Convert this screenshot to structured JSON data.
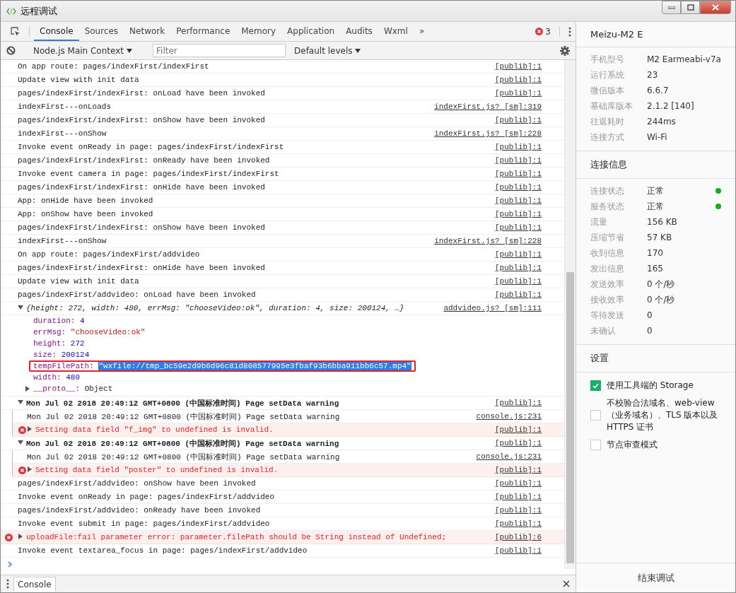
{
  "window": {
    "title": "远程调试"
  },
  "tabs": [
    {
      "label": "Console",
      "selected": true
    },
    {
      "label": "Sources",
      "selected": false
    },
    {
      "label": "Network",
      "selected": false
    },
    {
      "label": "Performance",
      "selected": false
    },
    {
      "label": "Memory",
      "selected": false
    },
    {
      "label": "Application",
      "selected": false
    },
    {
      "label": "Audits",
      "selected": false
    },
    {
      "label": "Wxml",
      "selected": false
    }
  ],
  "overflow": "»",
  "error_count": "3",
  "toolbar": {
    "context": "Node.js Main Context",
    "filter_placeholder": "Filter",
    "levels": "Default levels"
  },
  "console": [
    {
      "kind": "log",
      "text": "On app route: pages/indexFirst/indexFirst",
      "source": "[publib]:1"
    },
    {
      "kind": "log",
      "text": "Update view with init data",
      "source": "[publib]:1"
    },
    {
      "kind": "log",
      "text": "pages/indexFirst/indexFirst: onLoad have been invoked",
      "source": "[publib]:1"
    },
    {
      "kind": "log",
      "text": "indexFirst---onLoads",
      "source": "indexFirst.js? [sm]:319"
    },
    {
      "kind": "log",
      "text": "pages/indexFirst/indexFirst: onShow have been invoked",
      "source": "[publib]:1"
    },
    {
      "kind": "log",
      "text": "indexFirst---onShow",
      "source": "indexFirst.js? [sm]:228"
    },
    {
      "kind": "log",
      "text": "Invoke event onReady in page: pages/indexFirst/indexFirst",
      "source": "[publib]:1"
    },
    {
      "kind": "log",
      "text": "pages/indexFirst/indexFirst: onReady have been invoked",
      "source": "[publib]:1"
    },
    {
      "kind": "log",
      "text": "Invoke event camera in page: pages/indexFirst/indexFirst",
      "source": "[publib]:1"
    },
    {
      "kind": "log",
      "text": "pages/indexFirst/indexFirst: onHide have been invoked",
      "source": "[publib]:1"
    },
    {
      "kind": "log",
      "text": "App: onHide have been invoked",
      "source": "[publib]:1"
    },
    {
      "kind": "log",
      "text": "App: onShow have been invoked",
      "source": "[publib]:1"
    },
    {
      "kind": "log",
      "text": "pages/indexFirst/indexFirst: onShow have been invoked",
      "source": "[publib]:1"
    },
    {
      "kind": "log",
      "text": "indexFirst---onShow",
      "source": "indexFirst.js? [sm]:228"
    },
    {
      "kind": "log",
      "text": "On app route: pages/indexFirst/addvideo",
      "source": "[publib]:1"
    },
    {
      "kind": "log",
      "text": "pages/indexFirst/indexFirst: onHide have been invoked",
      "source": "[publib]:1"
    },
    {
      "kind": "log",
      "text": "Update view with init data",
      "source": "[publib]:1"
    },
    {
      "kind": "log",
      "text": "pages/indexFirst/addvideo: onLoad have been invoked",
      "source": "[publib]:1"
    },
    {
      "kind": "object",
      "expanded": true,
      "text": "{height: 272, width: 480, errMsg: \"chooseVideo:ok\", duration: 4, size: 200124, …}",
      "source": "addvideo.js? [sm]:111",
      "properties": [
        {
          "key": "duration:",
          "value": "4",
          "kind": "number",
          "selected": false,
          "boxed": false
        },
        {
          "key": "errMsg:",
          "value": "\"chooseVideo:ok\"",
          "kind": "string",
          "selected": false,
          "boxed": false
        },
        {
          "key": "height:",
          "value": "272",
          "kind": "number",
          "selected": false,
          "boxed": false
        },
        {
          "key": "size:",
          "value": "200124",
          "kind": "number",
          "selected": false,
          "boxed": false
        },
        {
          "key": "tempFilePath:",
          "value": "\"wxfile://tmp_bc59e2d9b6d96c81d808577995e3fbaf93b6bba911bb6c57.mp4\"",
          "kind": "string",
          "selected": true,
          "boxed": true
        },
        {
          "key": "width:",
          "value": "480",
          "kind": "number",
          "selected": false,
          "boxed": false
        },
        {
          "key": "__proto__:",
          "value": "Object",
          "kind": "object",
          "selected": false,
          "boxed": false
        }
      ]
    },
    {
      "kind": "group",
      "expanded": true,
      "text": "Mon Jul 02 2018 20:49:12 GMT+0800 (中国标准时间) Page setData warning",
      "source": "[publib]:1",
      "children": [
        {
          "kind": "log",
          "text": "Mon Jul 02 2018 20:49:12 GMT+0800 (中国标准时间) Page setData warning",
          "source": "console.js:231"
        },
        {
          "kind": "error",
          "expanded": false,
          "text": "Setting data field \"f_img\" to undefined is invalid.",
          "source": "[publib]:1"
        }
      ]
    },
    {
      "kind": "group",
      "expanded": true,
      "text": "Mon Jul 02 2018 20:49:12 GMT+0800 (中国标准时间) Page setData warning",
      "source": "[publib]:1",
      "children": [
        {
          "kind": "log",
          "text": "Mon Jul 02 2018 20:49:12 GMT+0800 (中国标准时间) Page setData warning",
          "source": "console.js:231"
        },
        {
          "kind": "error",
          "expanded": false,
          "text": "Setting data field \"poster\" to undefined is invalid.",
          "source": "[publib]:1"
        }
      ]
    },
    {
      "kind": "log",
      "text": "pages/indexFirst/addvideo: onShow have been invoked",
      "source": "[publib]:1"
    },
    {
      "kind": "log",
      "text": "Invoke event onReady in page: pages/indexFirst/addvideo",
      "source": "[publib]:1"
    },
    {
      "kind": "log",
      "text": "pages/indexFirst/addvideo: onReady have been invoked",
      "source": "[publib]:1"
    },
    {
      "kind": "log",
      "text": "Invoke event submit in page: pages/indexFirst/addvideo",
      "source": "[publib]:1"
    },
    {
      "kind": "error",
      "expanded": false,
      "text": "uploadFile:fail parameter error: parameter.filePath should be String instead of Undefined;",
      "source": "[publib]:6"
    },
    {
      "kind": "log",
      "text": "Invoke event textarea_focus in page: pages/indexFirst/addvideo",
      "source": "[publib]:1"
    }
  ],
  "drawer_tab": "Console",
  "device": {
    "name": "Meizu-M2 E",
    "info": [
      {
        "label": "手机型号",
        "value": "M2 Earmeabi-v7a"
      },
      {
        "label": "运行系统",
        "value": "23"
      },
      {
        "label": "微信版本",
        "value": "6.6.7"
      },
      {
        "label": "基础库版本",
        "value": "2.1.2 [140]"
      },
      {
        "label": "往返耗时",
        "value": "244ms"
      },
      {
        "label": "连接方式",
        "value": "Wi-Fi"
      }
    ]
  },
  "connection": {
    "title": "连接信息",
    "info": [
      {
        "label": "连接状态",
        "value": "正常",
        "color": "#1aad19"
      },
      {
        "label": "服务状态",
        "value": "正常",
        "color": "#1aad19"
      },
      {
        "label": "流量",
        "value": "156 KB"
      },
      {
        "label": "压缩节省",
        "value": "57 KB"
      },
      {
        "label": "收到信息",
        "value": "170"
      },
      {
        "label": "发出信息",
        "value": "165"
      },
      {
        "label": "发送效率",
        "value": "0 个/秒"
      },
      {
        "label": "接收效率",
        "value": "0 个/秒"
      },
      {
        "label": "等待发送",
        "value": "0"
      },
      {
        "label": "未确认",
        "value": "0"
      }
    ]
  },
  "settings": {
    "title": "设置",
    "options": [
      {
        "label": "使用工具端的 Storage",
        "checked": true
      },
      {
        "label": "不校验合法域名、web-view（业务域名）、TLS 版本以及 HTTPS 证书",
        "checked": false
      },
      {
        "label": "节点审查模式",
        "checked": false
      }
    ]
  },
  "end_button": "结束调试"
}
